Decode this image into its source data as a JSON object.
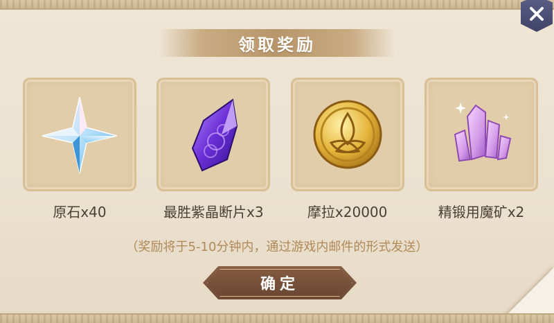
{
  "dialog": {
    "title": "领取奖励",
    "close_icon": "close-icon"
  },
  "rewards": [
    {
      "label": "原石x40",
      "icon": "primogem-icon"
    },
    {
      "label": "最胜紫晶断片x3",
      "icon": "amethyst-fragment-icon"
    },
    {
      "label": "摩拉x20000",
      "icon": "mora-coin-icon"
    },
    {
      "label": "精锻用魔矿x2",
      "icon": "mystic-enhancement-ore-icon"
    }
  ],
  "notice": "（奖励将于5-10分钟内，通过游戏内邮件的形式发送）",
  "confirm_button": {
    "label": "确定"
  },
  "colors": {
    "background": "#ebe1cf",
    "slot": "#e2cdaa",
    "title_band": "#b8956a",
    "notice_text": "#b08958",
    "button": "#6e4a35",
    "close_button": "#4a4e72"
  }
}
